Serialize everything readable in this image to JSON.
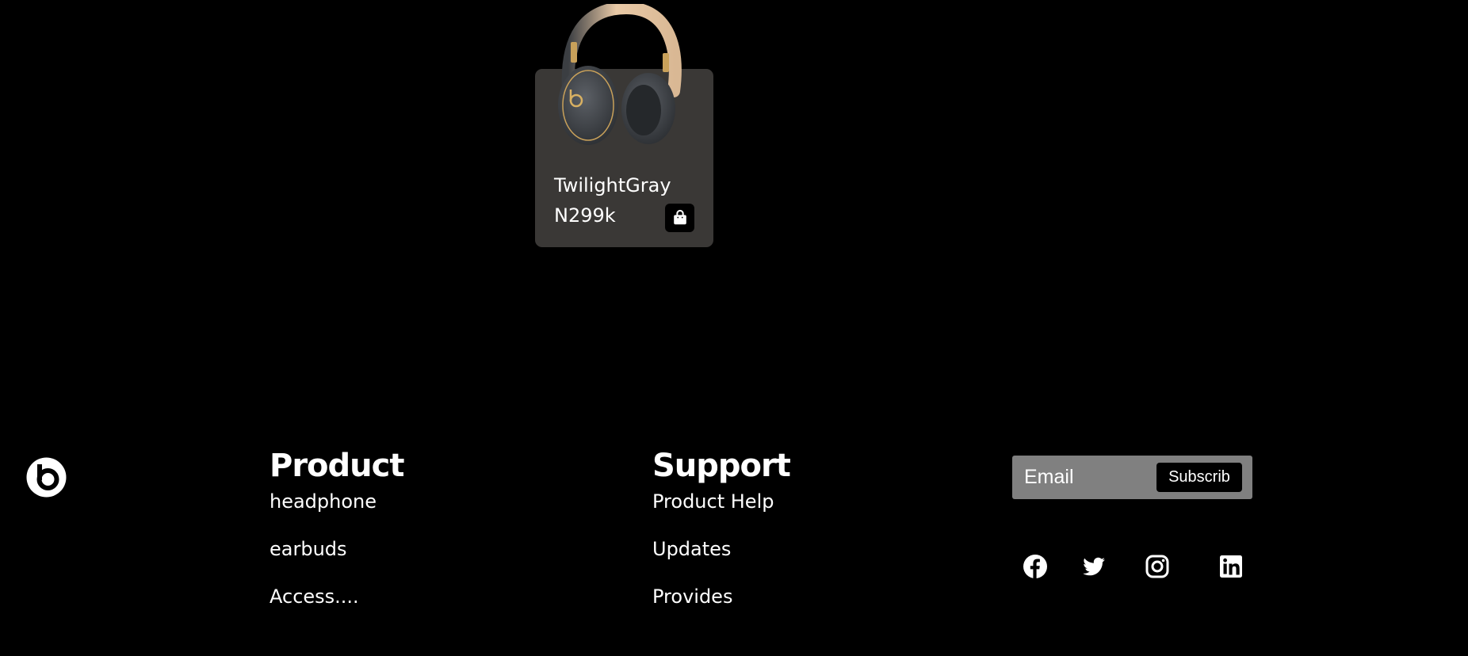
{
  "product": {
    "name": "TwilightGray",
    "price": "N299k",
    "image_icon": "headphones-image",
    "cart_icon": "shopping-bag-icon"
  },
  "footer": {
    "logo_icon": "beats-logo-icon",
    "product_column": {
      "heading": "Product",
      "links": [
        "headphone",
        "earbuds",
        "Access...."
      ]
    },
    "support_column": {
      "heading": "Support",
      "links": [
        "Product Help",
        "Updates",
        "Provides"
      ]
    },
    "subscribe": {
      "email_placeholder": "Email",
      "button_label": "Subscrib"
    },
    "social_icons": [
      "facebook-icon",
      "twitter-icon",
      "instagram-icon",
      "linkedin-icon"
    ]
  },
  "colors": {
    "background": "#000000",
    "card": "#3a3836",
    "subscribe_box": "#808080",
    "text": "#ffffff"
  }
}
